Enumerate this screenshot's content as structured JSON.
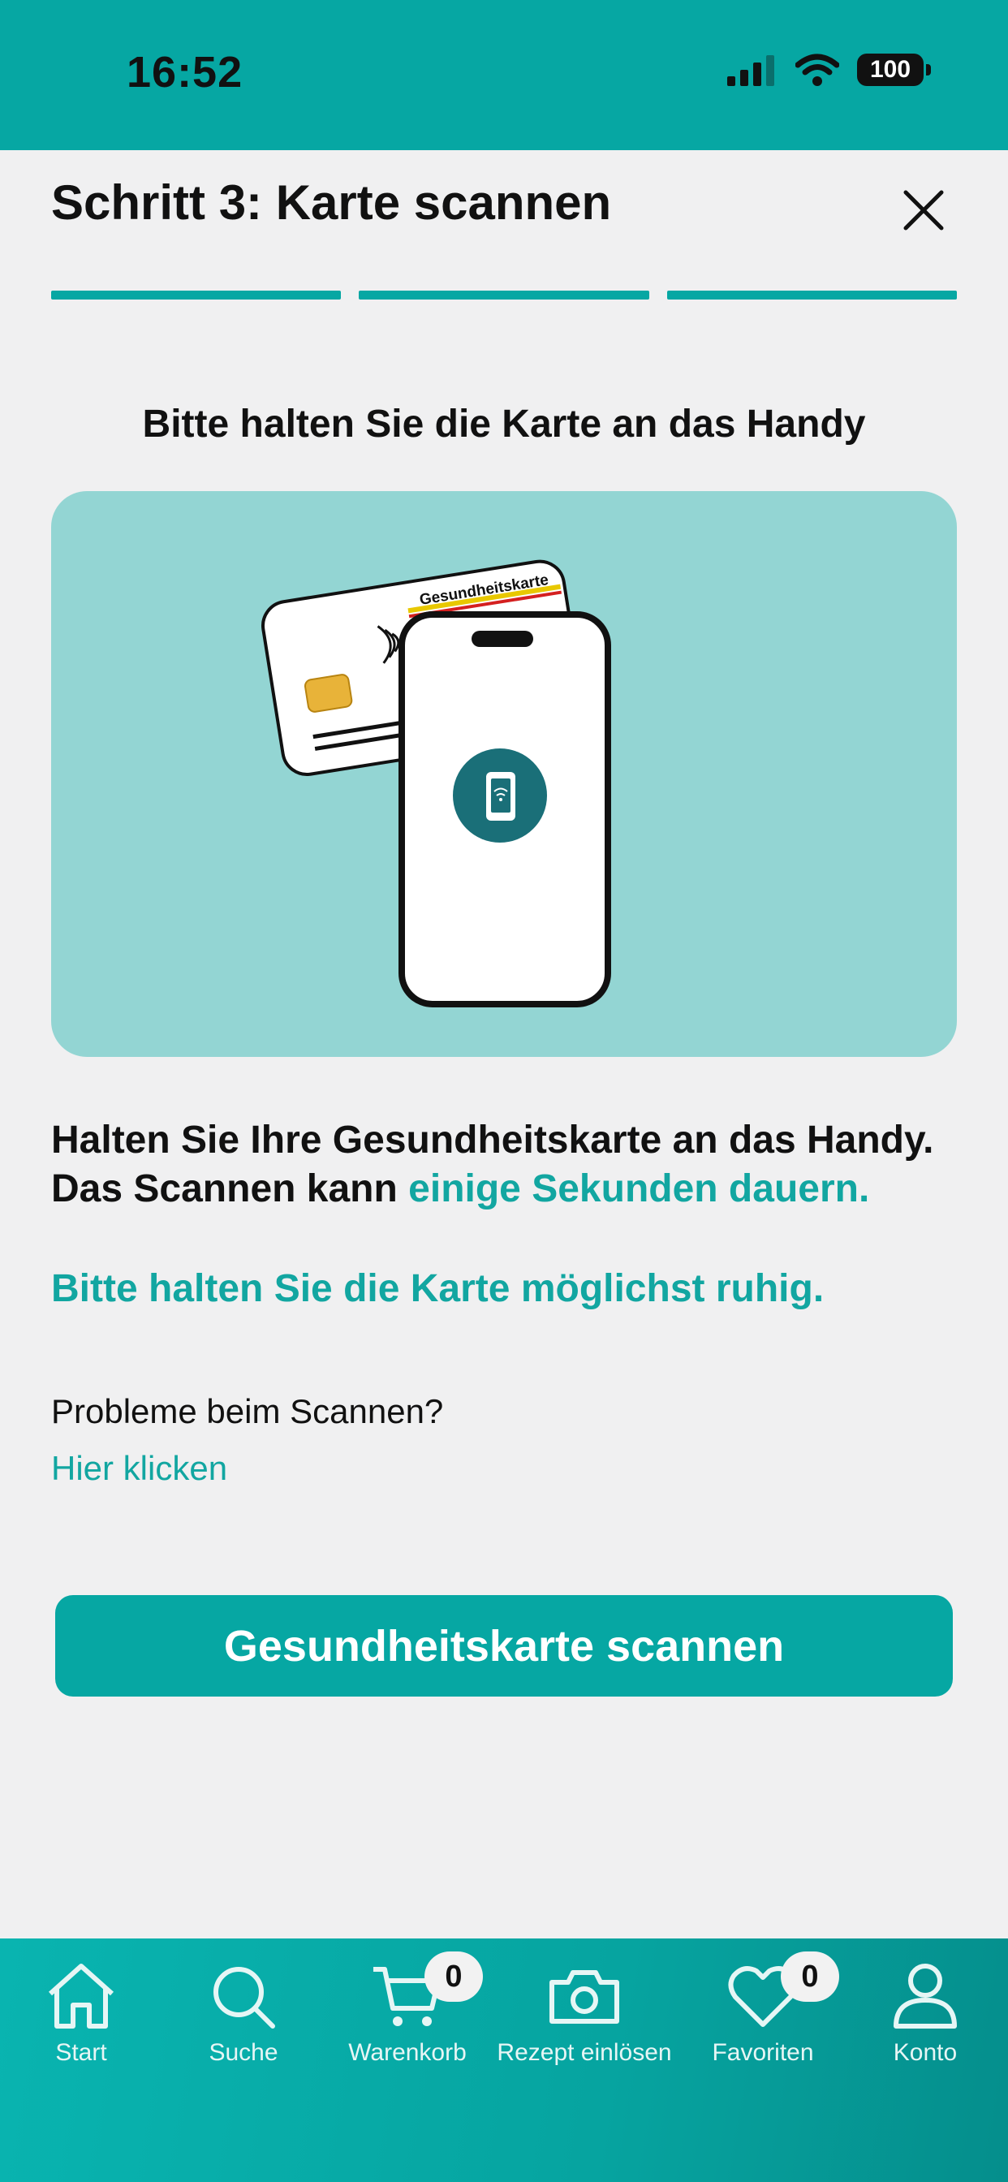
{
  "status_bar": {
    "time": "16:52",
    "battery": "100"
  },
  "header": {
    "title": "Schritt 3: Karte scannen"
  },
  "instruction": "Bitte halten Sie die Karte an das Handy",
  "illustration": {
    "card_label": "Gesundheitskarte"
  },
  "body": {
    "line_part1": "Halten Sie Ihre Gesundheitskarte an das Handy.",
    "line_part2": "Das Scannen kann",
    "line_accent": "einige Sekunden dauern.",
    "hint": "Bitte halten Sie die Karte möglichst ruhig."
  },
  "problem": {
    "label": "Probleme beim Scannen?",
    "link": "Hier klicken"
  },
  "scan_button": "Gesundheitskarte scannen",
  "nav": {
    "start": "Start",
    "suche": "Suche",
    "warenkorb": "Warenkorb",
    "warenkorb_count": "0",
    "rezept": "Rezept einlösen",
    "favoriten": "Favoriten",
    "favoriten_count": "0",
    "konto": "Konto"
  },
  "colors": {
    "accent": "#06a7a3",
    "illustration_bg": "#93d5d3",
    "page_bg": "#f0f0f1"
  },
  "progress": {
    "steps_total": 3,
    "steps_completed": 3
  }
}
